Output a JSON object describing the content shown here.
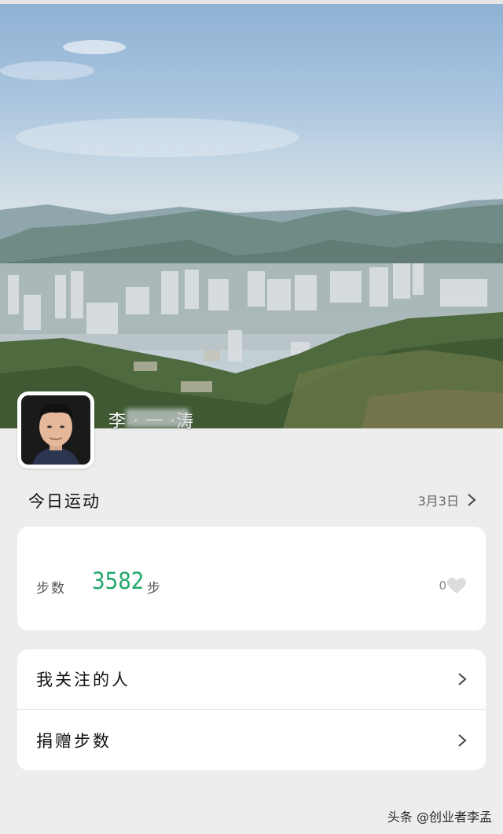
{
  "profile": {
    "username": "李 · 一 ·涛",
    "avatar": "avatar-photo"
  },
  "today": {
    "title": "今日运动",
    "date": "3月3日"
  },
  "steps": {
    "label": "步数",
    "value": "3582",
    "unit": "步",
    "likes": "0"
  },
  "menu": {
    "items": [
      {
        "label": "我关注的人"
      },
      {
        "label": "捐赠步数"
      }
    ]
  },
  "watermark": "头条 @创业者李孟",
  "colors": {
    "accent_green": "#22a86a",
    "background": "#ededed",
    "card": "#ffffff"
  }
}
